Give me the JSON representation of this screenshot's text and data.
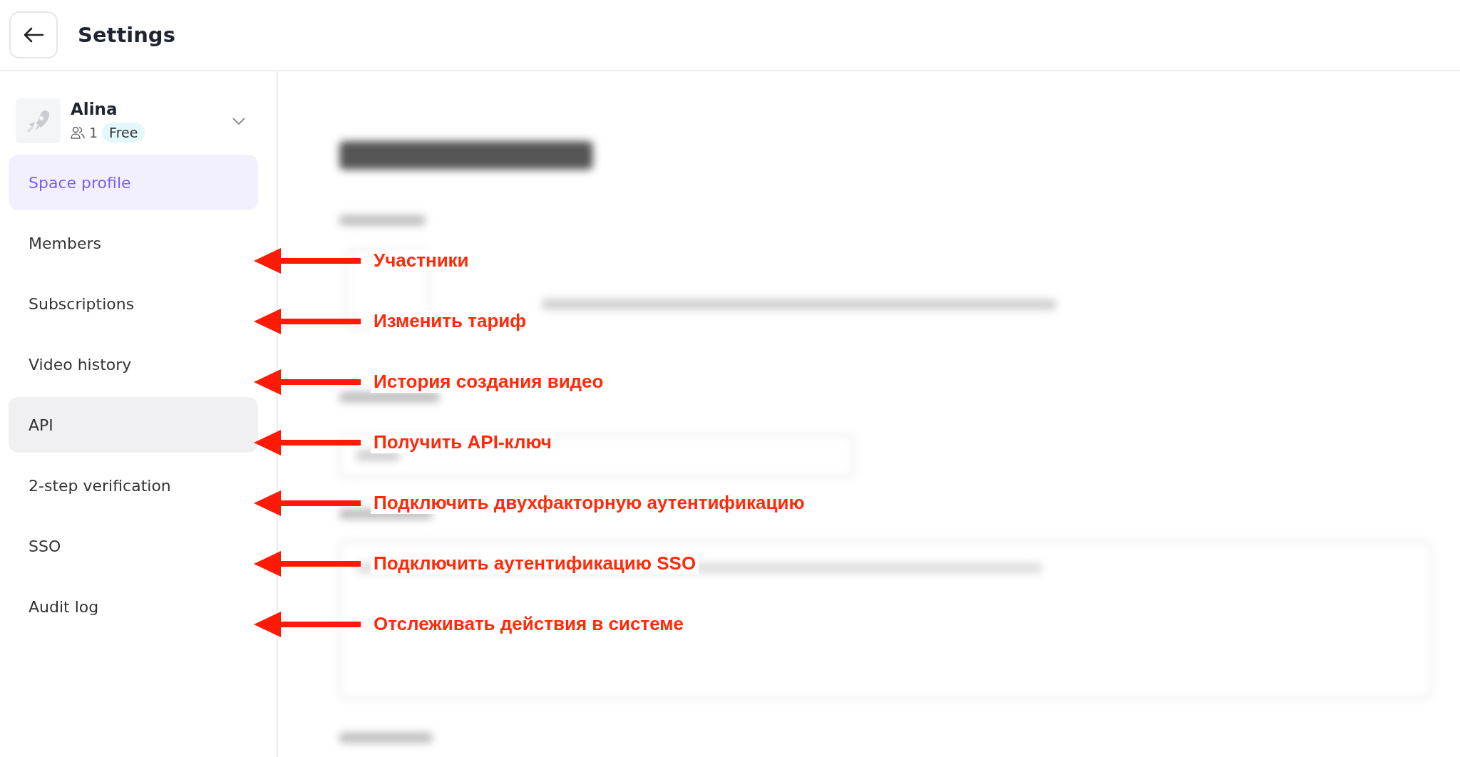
{
  "header": {
    "title": "Settings"
  },
  "space": {
    "name": "Alina",
    "members": "1",
    "plan": "Free"
  },
  "nav": [
    {
      "label": "Space profile",
      "selected": true,
      "highlighted": false
    },
    {
      "label": "Members",
      "selected": false,
      "highlighted": false,
      "annotation": "Участники"
    },
    {
      "label": "Subscriptions",
      "selected": false,
      "highlighted": false,
      "annotation": "Изменить тариф"
    },
    {
      "label": "Video history",
      "selected": false,
      "highlighted": false,
      "annotation": "История создания видео"
    },
    {
      "label": "API",
      "selected": false,
      "highlighted": true,
      "annotation": "Получить API-ключ"
    },
    {
      "label": "2-step verification",
      "selected": false,
      "highlighted": false,
      "annotation": "Подключить двухфакторную аутентификацию"
    },
    {
      "label": "SSO",
      "selected": false,
      "highlighted": false,
      "annotation": "Подключить аутентификацию SSO"
    },
    {
      "label": "Audit log",
      "selected": false,
      "highlighted": false,
      "annotation": "Отслеживать действия в системе"
    }
  ]
}
